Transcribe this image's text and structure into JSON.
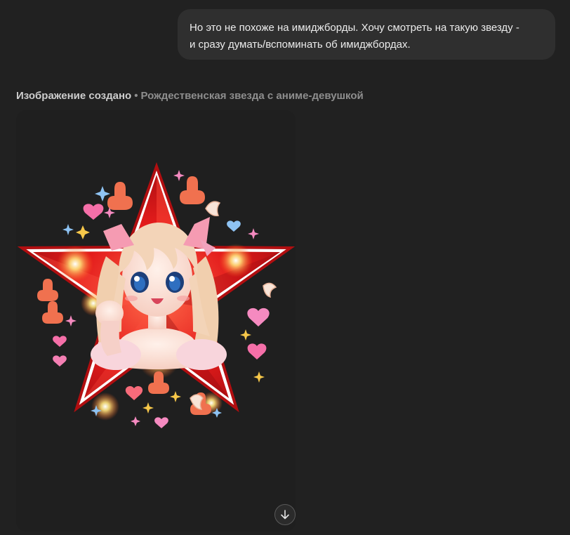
{
  "user_message": {
    "line1": "Но это не похоже на имиджборды. Хочу смотреть на такую звезду -",
    "line2": "и сразу думать/вспоминать об имиджбордах."
  },
  "assistant": {
    "status_label": "Изображение создано",
    "separator": "•",
    "prompt_title": "Рождественская звезда с аниме-девушкой"
  },
  "image": {
    "subject": "red star with anime girl",
    "star_color": "#e31b1b",
    "outline_color": "#ffffff",
    "hair_color": "#f3d4b8",
    "eye_color": "#2f6fc0"
  },
  "controls": {
    "download_icon": "arrow-down-icon"
  },
  "colors": {
    "background": "#212121",
    "bubble": "#2f2f2f",
    "card": "#1f1f1f"
  }
}
